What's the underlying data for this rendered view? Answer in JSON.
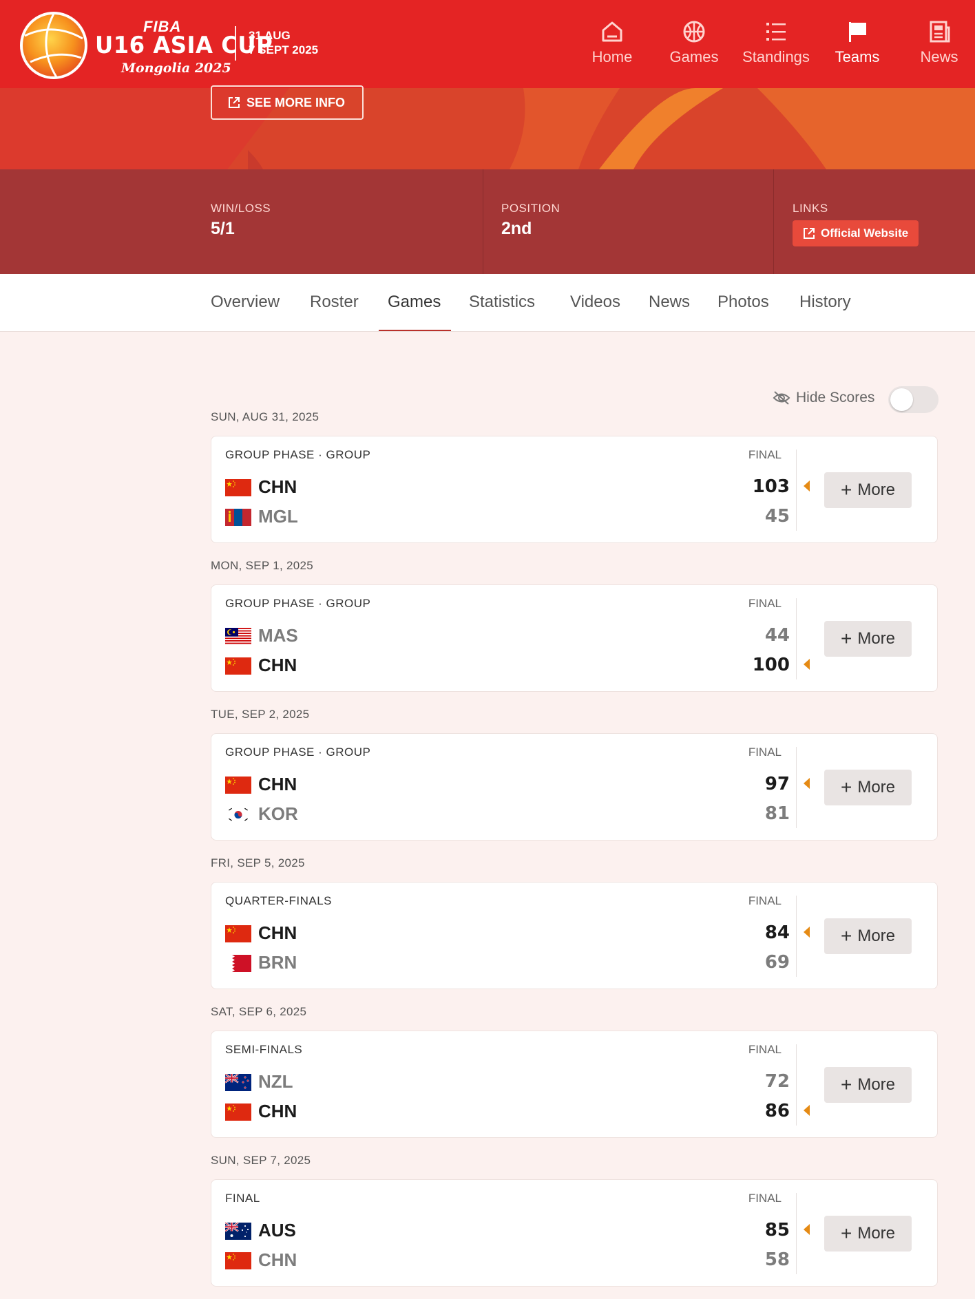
{
  "brand": {
    "fiba": "FIBA",
    "name": "U16 ASIA CUP",
    "host": "Mongolia 2025",
    "date_start": "31 AUG",
    "date_end": "7 SEPT 2025"
  },
  "nav": [
    {
      "label": "Home",
      "icon": "home-icon"
    },
    {
      "label": "Games",
      "icon": "basketball-icon"
    },
    {
      "label": "Standings",
      "icon": "list-icon"
    },
    {
      "label": "Teams",
      "icon": "flag-icon",
      "active": true
    },
    {
      "label": "News",
      "icon": "newspaper-icon"
    }
  ],
  "hero": {
    "see_more": "SEE MORE INFO"
  },
  "stats": {
    "win_loss_label": "WIN/LOSS",
    "win_loss": "5/1",
    "position_label": "POSITION",
    "position": "2nd",
    "links_label": "LINKS",
    "official_website": "Official Website"
  },
  "tabs": [
    "Overview",
    "Roster",
    "Games",
    "Statistics",
    "Videos",
    "News",
    "Photos",
    "History"
  ],
  "active_tab": "Games",
  "hide_scores": {
    "label": "Hide Scores",
    "enabled": false
  },
  "more_label": "More",
  "games": [
    {
      "date": "SUN, AUG 31, 2025",
      "phase": "GROUP PHASE · GROUP",
      "status": "FINAL",
      "teams": [
        {
          "code": "CHN",
          "score": "103",
          "winner": true
        },
        {
          "code": "MGL",
          "score": "45",
          "winner": false
        }
      ]
    },
    {
      "date": "MON, SEP 1, 2025",
      "phase": "GROUP PHASE · GROUP",
      "status": "FINAL",
      "teams": [
        {
          "code": "MAS",
          "score": "44",
          "winner": false
        },
        {
          "code": "CHN",
          "score": "100",
          "winner": true
        }
      ]
    },
    {
      "date": "TUE, SEP 2, 2025",
      "phase": "GROUP PHASE · GROUP",
      "status": "FINAL",
      "teams": [
        {
          "code": "CHN",
          "score": "97",
          "winner": true
        },
        {
          "code": "KOR",
          "score": "81",
          "winner": false
        }
      ]
    },
    {
      "date": "FRI, SEP 5, 2025",
      "phase": "QUARTER-FINALS",
      "status": "FINAL",
      "teams": [
        {
          "code": "CHN",
          "score": "84",
          "winner": true
        },
        {
          "code": "BRN",
          "score": "69",
          "winner": false
        }
      ]
    },
    {
      "date": "SAT, SEP 6, 2025",
      "phase": "SEMI-FINALS",
      "status": "FINAL",
      "teams": [
        {
          "code": "NZL",
          "score": "72",
          "winner": false
        },
        {
          "code": "CHN",
          "score": "86",
          "winner": true
        }
      ]
    },
    {
      "date": "SUN, SEP 7, 2025",
      "phase": "FINAL",
      "status": "FINAL",
      "teams": [
        {
          "code": "AUS",
          "score": "85",
          "winner": true
        },
        {
          "code": "CHN",
          "score": "58",
          "winner": false
        }
      ]
    }
  ],
  "colors": {
    "primary": "#e42424",
    "band": "#a33636",
    "accent": "#e58a14",
    "page_bg": "#fcf1ef"
  }
}
